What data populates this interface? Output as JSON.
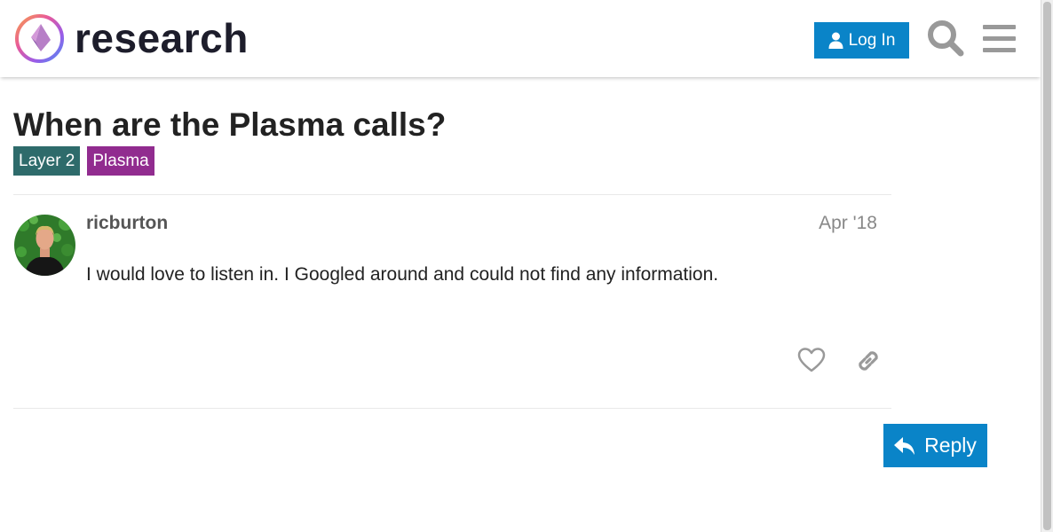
{
  "header": {
    "site_name": "research",
    "login_label": "Log In",
    "icons": {
      "logo": "ethereum-diamond-ring-logo",
      "login": "user-icon",
      "search": "search-icon",
      "menu": "hamburger-menu-icon"
    },
    "colors": {
      "primary": "#0a84c8"
    }
  },
  "topic": {
    "title": "When are the Plasma calls?",
    "tags": [
      {
        "label": "Layer 2",
        "color": "#2e6b6b"
      },
      {
        "label": "Plasma",
        "color": "#912c8f"
      }
    ]
  },
  "post": {
    "username": "ricburton",
    "date": "Apr '18",
    "body": "I would love to listen in. I Googled around and could not find any information.",
    "actions": [
      "heart-icon",
      "link-icon"
    ]
  },
  "footer": {
    "reply_label": "Reply",
    "reply_icon": "reply-arrow-icon"
  }
}
